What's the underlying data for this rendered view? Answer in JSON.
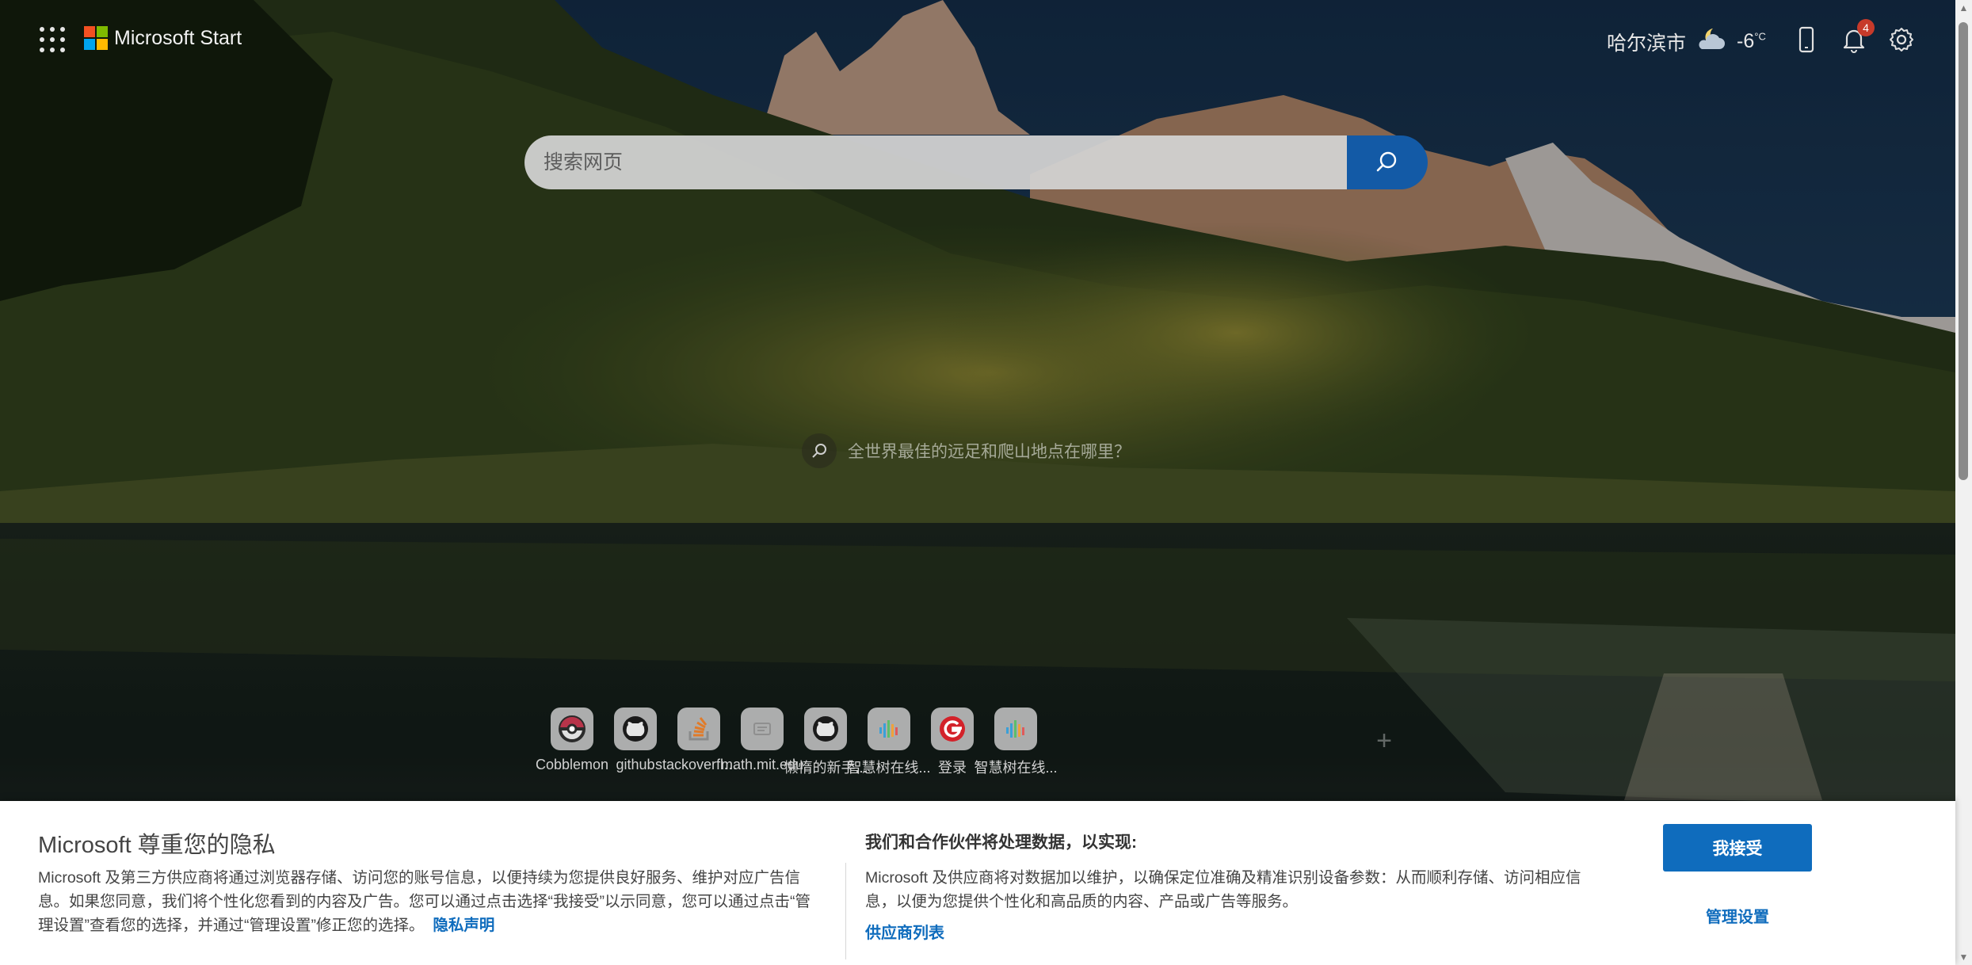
{
  "header": {
    "brand": "Microsoft Start",
    "location": "哈尔滨市",
    "temperature": "-6",
    "temperature_unit": "°C",
    "weather_icon": "partly-cloudy-night-icon",
    "notification_count": "4",
    "icons": [
      "apps-grid-icon",
      "phone-icon",
      "bell-icon",
      "gear-icon"
    ]
  },
  "search": {
    "placeholder": "搜索网页"
  },
  "image_query": {
    "text": "全世界最佳的远足和爬山地点在哪里？"
  },
  "quick_links": [
    {
      "label": "Cobblemon",
      "icon": "pokeball-icon"
    },
    {
      "label": "github",
      "icon": "github-icon"
    },
    {
      "label": "stackoverflo...",
      "icon": "stackoverflow-icon"
    },
    {
      "label": "math.mit.edu",
      "icon": "generic-site-icon"
    },
    {
      "label": "懒惰的新手...",
      "icon": "github-icon"
    },
    {
      "label": "智慧树在线...",
      "icon": "audio-bars-icon"
    },
    {
      "label": "登录",
      "icon": "g-logo-icon"
    },
    {
      "label": "智慧树在线...",
      "icon": "audio-bars-icon"
    }
  ],
  "consent": {
    "title": "Microsoft 尊重您的隐私",
    "body": "Microsoft 及第三方供应商将通过浏览器存储、访问您的账号信息，以便持续为您提供良好服务、维护对应广告信息。如果您同意，我们将个性化您看到的内容及广告。您可以通过点击选择“我接受”以示同意，您可以通过点击“管理设置”查看您的选择，并通过“管理设置”修正您的选择。",
    "privacy_link": "隐私声明",
    "subtitle": "我们和合作伙伴将处理数据，以实现:",
    "body2": "Microsoft 及供应商将对数据加以维护，以确保定位准确及精准识别设备参数：从而顺利存储、访问相应信息，以便为您提供个性化和高品质的内容、产品或广告等服务。",
    "vendor_link": "供应商列表",
    "accept_label": "我接受",
    "manage_label": "管理设置"
  },
  "colors": {
    "accent": "#0f6cbd",
    "search_button": "#135aa6",
    "badge": "#c73a2a"
  }
}
